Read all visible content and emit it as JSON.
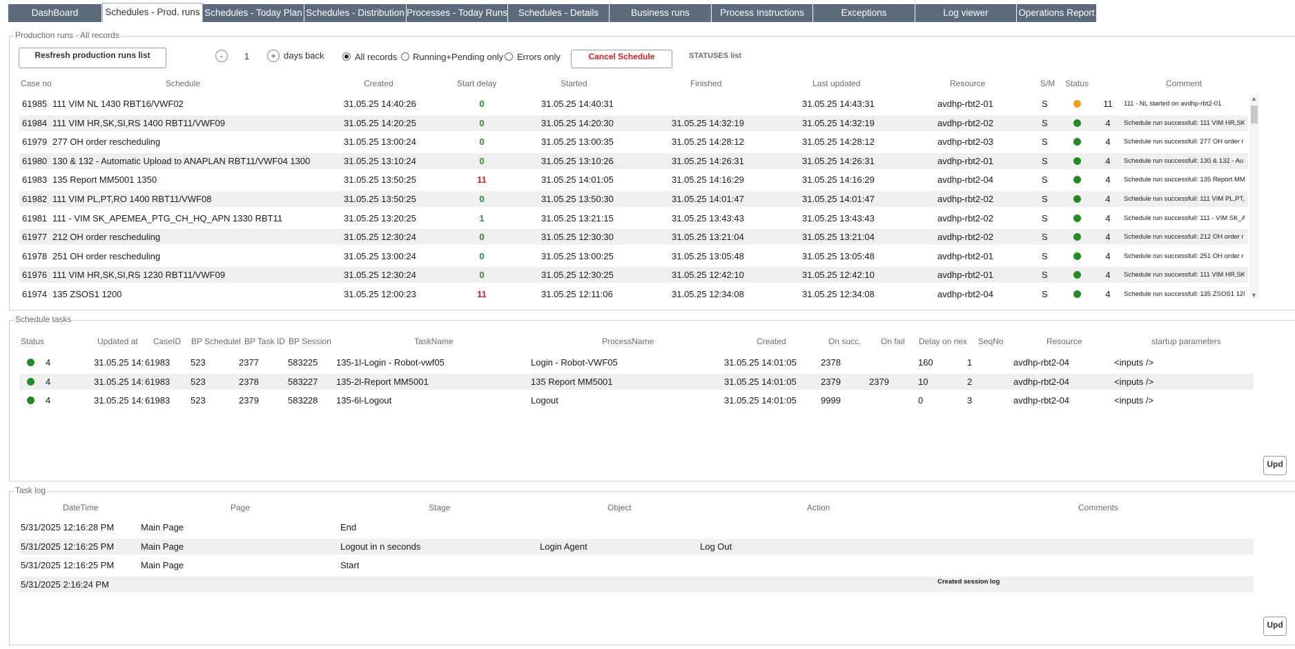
{
  "tabs": [
    {
      "label": "DashBoard",
      "active": false
    },
    {
      "label": "Schedules - Prod. runs",
      "active": true
    },
    {
      "label": "Schedules - Today Plan",
      "active": false
    },
    {
      "label": "Schedules - Distribution",
      "active": false
    },
    {
      "label": "Processes - Today Runs",
      "active": false
    },
    {
      "label": "Schedules - Details",
      "active": false
    },
    {
      "label": "Business runs",
      "active": false
    },
    {
      "label": "Process Instructions",
      "active": false
    },
    {
      "label": "Exceptions",
      "active": false
    },
    {
      "label": "Log viewer",
      "active": false
    },
    {
      "label": "Operations Report",
      "active": false
    }
  ],
  "production": {
    "legend": "Production runs - All records",
    "refresh_label": "Resfresh production runs list",
    "minus": "-",
    "days_value": "1",
    "plus": "+",
    "days_back_label": "days back",
    "radio_all": "All records",
    "radio_running": "Running+Pending only",
    "radio_errors": "Errors only",
    "cancel_label": "Cancel Schedule",
    "statuses_label": "STATUSES list",
    "headers": [
      "Case no",
      "Schedule",
      "Created",
      "Start delay",
      "Started",
      "Finished",
      "Last updated",
      "Resource",
      "S/M",
      "Status",
      "Comment"
    ],
    "rows": [
      {
        "case": "61985",
        "schedule": "111 VIM NL 1430 RBT16/VWF02",
        "created": "31.05.25 14:40:26",
        "delay": "0",
        "started": "31.05.25 14:40:31",
        "finished": "",
        "updated": "31.05.25 14:43:31",
        "resource": "avdhp-rbt2-01",
        "sm": "S",
        "status": "11",
        "comment": "111 - NL started on avdhp-rbt2-01",
        "dot": "#f0a020",
        "delay_color": "#2e8b2e"
      },
      {
        "case": "61984",
        "schedule": "111 VIM HR,SK,SI,RS 1400 RBT11/VWF09",
        "created": "31.05.25 14:20:25",
        "delay": "0",
        "started": "31.05.25 14:20:30",
        "finished": "31.05.25 14:32:19",
        "updated": "31.05.25 14:32:19",
        "resource": "avdhp-rbt2-02",
        "sm": "S",
        "status": "4",
        "comment": "Schedule run successfull: 111 VIM HR,SK",
        "dot": "#228b22",
        "delay_color": "#2e8b2e"
      },
      {
        "case": "61979",
        "schedule": "277 OH order rescheduling",
        "created": "31.05.25 13:00:24",
        "delay": "0",
        "started": "31.05.25 13:00:35",
        "finished": "31.05.25 14:28:12",
        "updated": "31.05.25 14:28:12",
        "resource": "avdhp-rbt2-03",
        "sm": "S",
        "status": "4",
        "comment": "Schedule run successfull: 277 OH order r",
        "dot": "#228b22",
        "delay_color": "#2e8b2e"
      },
      {
        "case": "61980",
        "schedule": "130 & 132 - Automatic Upload to ANAPLAN RBT11/VWF04 1300",
        "created": "31.05.25 13:10:24",
        "delay": "0",
        "started": "31.05.25 13:10:26",
        "finished": "31.05.25 14:26:31",
        "updated": "31.05.25 14:26:31",
        "resource": "avdhp-rbt2-01",
        "sm": "S",
        "status": "4",
        "comment": "Schedule run successfull: 130 & 132 - Au",
        "dot": "#228b22",
        "delay_color": "#2e8b2e"
      },
      {
        "case": "61983",
        "schedule": "135 Report MM5001 1350",
        "created": "31.05.25 13:50:25",
        "delay": "11",
        "started": "31.05.25 14:01:05",
        "finished": "31.05.25 14:16:29",
        "updated": "31.05.25 14:16:29",
        "resource": "avdhp-rbt2-04",
        "sm": "S",
        "status": "4",
        "comment": "Schedule run successfull: 135 Report MM",
        "dot": "#228b22",
        "delay_color": "#d62020"
      },
      {
        "case": "61982",
        "schedule": "111 VIM PL,PT,RO 1400 RBT11/VWF08",
        "created": "31.05.25 13:50:25",
        "delay": "0",
        "started": "31.05.25 13:50:30",
        "finished": "31.05.25 14:01:47",
        "updated": "31.05.25 14:01:47",
        "resource": "avdhp-rbt2-02",
        "sm": "S",
        "status": "4",
        "comment": "Schedule run successfull: 111 VIM PL,PT,",
        "dot": "#228b22",
        "delay_color": "#2e8b2e"
      },
      {
        "case": "61981",
        "schedule": "111 - VIM SK_APEMEA_PTG_CH_HQ_APN 1330 RBT11",
        "created": "31.05.25 13:20:25",
        "delay": "1",
        "started": "31.05.25 13:21:15",
        "finished": "31.05.25 13:43:43",
        "updated": "31.05.25 13:43:43",
        "resource": "avdhp-rbt2-02",
        "sm": "S",
        "status": "4",
        "comment": "Schedule run successfull: 111 - VIM SK_A",
        "dot": "#228b22",
        "delay_color": "#2e8b2e"
      },
      {
        "case": "61977",
        "schedule": "212 OH order rescheduling",
        "created": "31.05.25 12:30:24",
        "delay": "0",
        "started": "31.05.25 12:30:30",
        "finished": "31.05.25 13:21:04",
        "updated": "31.05.25 13:21:04",
        "resource": "avdhp-rbt2-02",
        "sm": "S",
        "status": "4",
        "comment": "Schedule run successfull: 212 OH order r",
        "dot": "#228b22",
        "delay_color": "#2e8b2e"
      },
      {
        "case": "61978",
        "schedule": "251 OH order rescheduling",
        "created": "31.05.25 13:00:24",
        "delay": "0",
        "started": "31.05.25 13:00:25",
        "finished": "31.05.25 13:05:48",
        "updated": "31.05.25 13:05:48",
        "resource": "avdhp-rbt2-01",
        "sm": "S",
        "status": "4",
        "comment": "Schedule run successfull: 251 OH order r",
        "dot": "#228b22",
        "delay_color": "#2e8b2e"
      },
      {
        "case": "61976",
        "schedule": "111 VIM HR,SK,SI,RS 1230 RBT11/VWF09",
        "created": "31.05.25 12:30:24",
        "delay": "0",
        "started": "31.05.25 12:30:25",
        "finished": "31.05.25 12:42:10",
        "updated": "31.05.25 12:42:10",
        "resource": "avdhp-rbt2-01",
        "sm": "S",
        "status": "4",
        "comment": "Schedule run successfull: 111 VIM HR,SK",
        "dot": "#228b22",
        "delay_color": "#2e8b2e"
      },
      {
        "case": "61974",
        "schedule": "135 ZSOS1 1200",
        "created": "31.05.25 12:00:23",
        "delay": "11",
        "started": "31.05.25 12:11:06",
        "finished": "31.05.25 12:34:08",
        "updated": "31.05.25 12:34:08",
        "resource": "avdhp-rbt2-04",
        "sm": "S",
        "status": "4",
        "comment": "Schedule run successfull: 135 ZSOS1 120",
        "dot": "#228b22",
        "delay_color": "#d62020"
      }
    ]
  },
  "tasks": {
    "legend": "Schedule tasks",
    "headers": [
      "Status",
      "Updated at",
      "CaseID",
      "BP Schedulel",
      "BP Task ID",
      "BP Session ID",
      "TaskName",
      "ProcessName",
      "Created",
      "On succ.",
      "On fail",
      "Delay on nex",
      "SeqNo",
      "Resource",
      "startup parameters"
    ],
    "rows": [
      {
        "status": "4",
        "updated": "31.05.25 14:",
        "caseid": "61983",
        "bpsched": "523",
        "taskid": "2377",
        "session": "583225",
        "taskname": "135-1l-Login - Robot-vwf05",
        "process": "Login - Robot-VWF05",
        "created": "31.05.25 14:01:05",
        "onsucc": "2378",
        "onfail": "",
        "delay": "160",
        "seq": "1",
        "resource": "avdhp-rbt2-04",
        "params": "<inputs />"
      },
      {
        "status": "4",
        "updated": "31.05.25 14:",
        "caseid": "61983",
        "bpsched": "523",
        "taskid": "2378",
        "session": "583227",
        "taskname": "135-2l-Report MM5001",
        "process": "135 Report MM5001",
        "created": "31.05.25 14:01:05",
        "onsucc": "2379",
        "onfail": "2379",
        "delay": "10",
        "seq": "2",
        "resource": "avdhp-rbt2-04",
        "params": "<inputs />"
      },
      {
        "status": "4",
        "updated": "31.05.25 14:",
        "caseid": "61983",
        "bpsched": "523",
        "taskid": "2379",
        "session": "583228",
        "taskname": "135-6l-Logout",
        "process": "Logout",
        "created": "31.05.25 14:01:05",
        "onsucc": "9999",
        "onfail": "",
        "delay": "0",
        "seq": "3",
        "resource": "avdhp-rbt2-04",
        "params": "<inputs />"
      }
    ],
    "upd_label": "Upd"
  },
  "tasklog": {
    "legend": "Task log",
    "headers": [
      "DateTime",
      "Page",
      "Stage",
      "Object",
      "Action",
      "Comments"
    ],
    "rows": [
      {
        "datetime": "5/31/2025 12:16:28 PM",
        "page": "Main Page",
        "stage": "End",
        "object": "",
        "action": "",
        "comments": ""
      },
      {
        "datetime": "5/31/2025 12:16:25 PM",
        "page": "Main Page",
        "stage": "Logout in n seconds",
        "object": "Login Agent",
        "action": "Log Out",
        "comments": ""
      },
      {
        "datetime": "5/31/2025 12:16:25 PM",
        "page": "Main Page",
        "stage": "Start",
        "object": "",
        "action": "",
        "comments": ""
      },
      {
        "datetime": "5/31/2025 2:16:24 PM",
        "page": "",
        "stage": "",
        "object": "",
        "action": "",
        "comments": "Created session log"
      }
    ],
    "upd_label": "Upd"
  },
  "colors": {
    "tab_bg": "#5b6b7c",
    "ok": "#228b22",
    "warn": "#f0a020",
    "error": "#d62020",
    "cancel": "#d62020"
  }
}
